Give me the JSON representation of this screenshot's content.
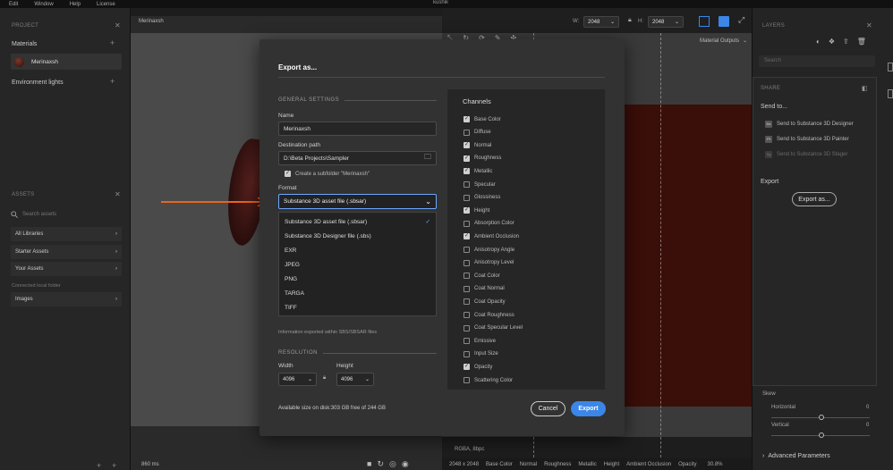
{
  "menu": [
    "Edit",
    "Window",
    "Help",
    "License"
  ],
  "app_title": "kushik",
  "left": {
    "project_header": "PROJECT",
    "materials_label": "Materials",
    "material_name": "Merinaxsh",
    "env_label": "Environment lights",
    "assets_header": "ASSETS",
    "search_placeholder": "Search assets",
    "libraries": [
      "All Libraries",
      "Starter Assets",
      "Your Assets"
    ],
    "connected_label": "Connected local folder",
    "images_label": "Images"
  },
  "viewport": {
    "material_label": "Merinaxsh",
    "time_label": "860 ms"
  },
  "topbar": {
    "w_label": "W:",
    "w_value": "2048",
    "h_label": "H:",
    "h_value": "2048",
    "output_label": "Material Outputs"
  },
  "view2d": {
    "format_label": "RGBA, 8bpc",
    "status_items": [
      "2048 x 2048",
      "Base Color",
      "Normal",
      "Roughness",
      "Metallic",
      "Height",
      "Ambient Occlusion",
      "Opacity",
      "30.8%"
    ]
  },
  "right": {
    "layers_header": "LAYERS",
    "search_placeholder": "Search",
    "share_header": "SHARE",
    "send_to_label": "Send to...",
    "send_items": [
      {
        "icon": "Ds",
        "label": "Send to Substance 3D Designer"
      },
      {
        "icon": "Pt",
        "label": "Send to Substance 3D Painter"
      },
      {
        "icon": "Sg",
        "label": "Send to Substance 3D Stager"
      }
    ],
    "export_section": "Export",
    "export_as_button": "Export as...",
    "skew_label": "Skew",
    "horizontal_label": "Horizontal",
    "horizontal_value": "0",
    "vertical_label": "Vertical",
    "vertical_value": "0",
    "advanced_label": "Advanced Parameters"
  },
  "dialog": {
    "title": "Export as...",
    "general_settings": "GENERAL SETTINGS",
    "name_label": "Name",
    "name_value": "Merinaxsh",
    "dest_label": "Destination path",
    "dest_value": "D:\\Beta Projects\\Sampler",
    "subfolder_label": "Create a subfolder \"Merinaxsh\"",
    "format_label": "Format",
    "format_value": "Substance 3D asset file (.sbsar)",
    "format_options": [
      "Substance 3D asset file (.sbsar)",
      "Substance 3D Designer file (.sbs)",
      "EXR",
      "JPEG",
      "PNG",
      "TARGA",
      "TIFF"
    ],
    "info_text": "Information exported within SBS/SBSAR files",
    "resolution_header": "RESOLUTION",
    "width_label": "Width",
    "width_value": "4096",
    "height_label": "Height",
    "height_value": "4096",
    "disk_info": "Available size on disk:303 GB free of 244 GB",
    "cancel_label": "Cancel",
    "export_label": "Export",
    "channels_title": "Channels",
    "channels": [
      {
        "name": "Base Color",
        "checked": true
      },
      {
        "name": "Diffuse",
        "checked": false
      },
      {
        "name": "Normal",
        "checked": true
      },
      {
        "name": "Roughness",
        "checked": true
      },
      {
        "name": "Metallic",
        "checked": true
      },
      {
        "name": "Specular",
        "checked": false
      },
      {
        "name": "Glossiness",
        "checked": false
      },
      {
        "name": "Height",
        "checked": true
      },
      {
        "name": "Absorption Color",
        "checked": false
      },
      {
        "name": "Ambient Occlusion",
        "checked": true
      },
      {
        "name": "Anisotropy Angle",
        "checked": false
      },
      {
        "name": "Anisotropy Level",
        "checked": false
      },
      {
        "name": "Coat Color",
        "checked": false
      },
      {
        "name": "Coat Normal",
        "checked": false
      },
      {
        "name": "Coat Opacity",
        "checked": false
      },
      {
        "name": "Coat Roughness",
        "checked": false
      },
      {
        "name": "Coat Specular Level",
        "checked": false
      },
      {
        "name": "Emissive",
        "checked": false
      },
      {
        "name": "Input Size",
        "checked": false
      },
      {
        "name": "Opacity",
        "checked": true
      },
      {
        "name": "Scattering Color",
        "checked": false
      }
    ]
  },
  "colors": {
    "accent": "#3b86e8",
    "arrow": "#e8641e",
    "texture": "#3a0e09"
  }
}
